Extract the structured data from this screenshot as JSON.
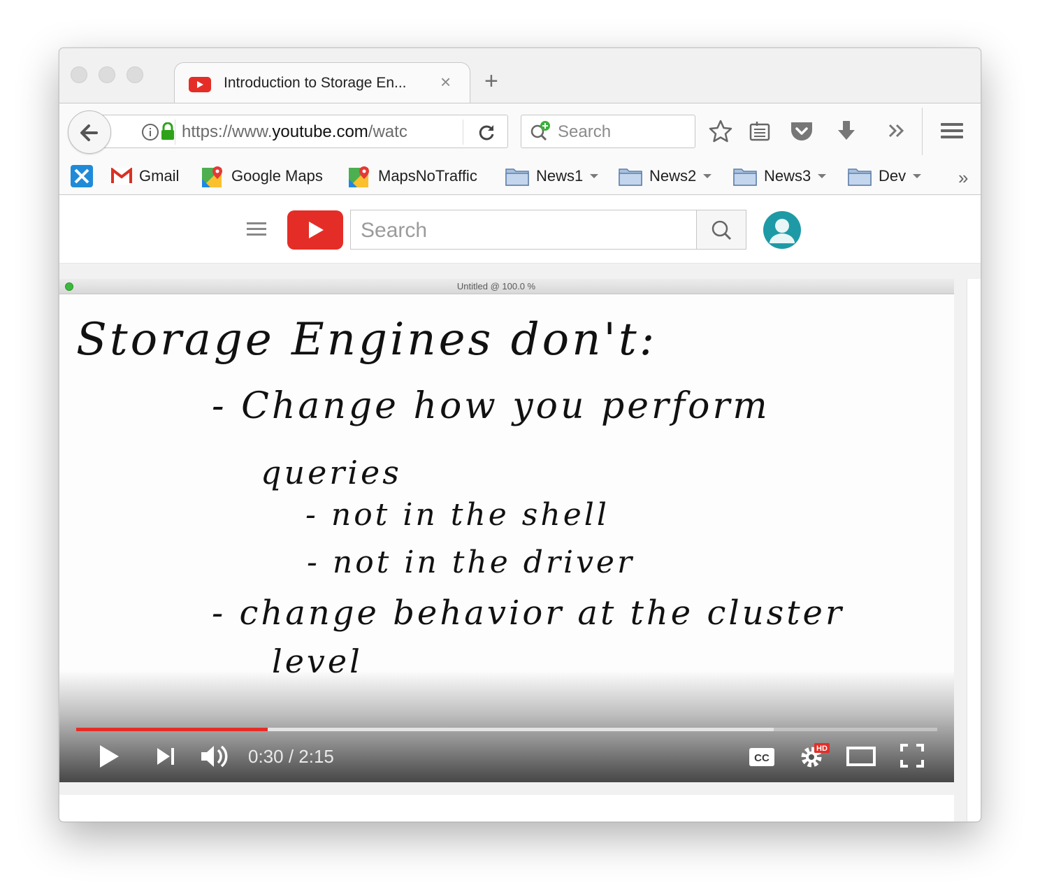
{
  "tab": {
    "title": "Introduction to Storage En...",
    "close": "×",
    "new": "+"
  },
  "nav": {
    "url_prefix": "https://www.",
    "url_host": "youtube.com",
    "url_suffix": "/watc",
    "search_placeholder": "Search"
  },
  "bookmarks": {
    "items": [
      {
        "label": "Gmail"
      },
      {
        "label": "Google Maps"
      },
      {
        "label": "MapsNoTraffic"
      },
      {
        "label": "News1"
      },
      {
        "label": "News2"
      },
      {
        "label": "News3"
      },
      {
        "label": "Dev"
      }
    ],
    "more": "»"
  },
  "youtube": {
    "search_placeholder": "Search"
  },
  "video": {
    "inner_window_title": "Untitled @ 100.0 %",
    "handwriting": [
      "Storage Engines don't:",
      "- Change how you perform",
      "queries",
      "- not in the shell",
      "- not in the driver",
      "- change behavior at the cluster",
      "level"
    ],
    "time": "0:30 / 2:15",
    "played_fraction": 0.222,
    "buffered_fraction": 0.81,
    "hd_badge": "HD",
    "cc_label": "CC"
  },
  "colors": {
    "youtube_red": "#e52d27",
    "progress_red": "#e52d27",
    "avatar_teal": "#1e9aa6"
  }
}
